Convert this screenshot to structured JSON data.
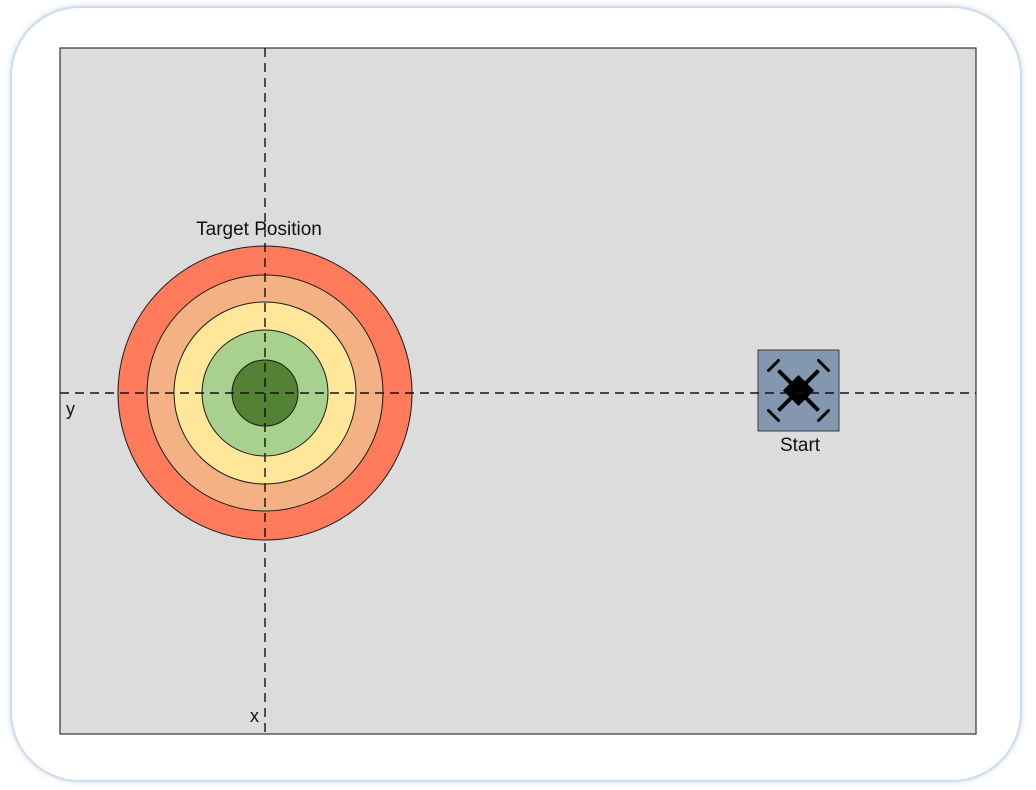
{
  "labels": {
    "target": "Target Position",
    "start": "Start",
    "y_axis": "y",
    "x_axis": "x"
  },
  "colors": {
    "frame_border": "#cfdcea",
    "field_fill": "#dcdcdc",
    "field_stroke": "#333333",
    "ring_outer": "#ff7b5c",
    "ring_2": "#f4b183",
    "ring_3": "#ffe699",
    "ring_4": "#a9d18e",
    "ring_center": "#548235",
    "start_box_fill": "#8497b0",
    "drone": "#000000"
  },
  "icons": {
    "drone": "quadcopter-icon"
  }
}
